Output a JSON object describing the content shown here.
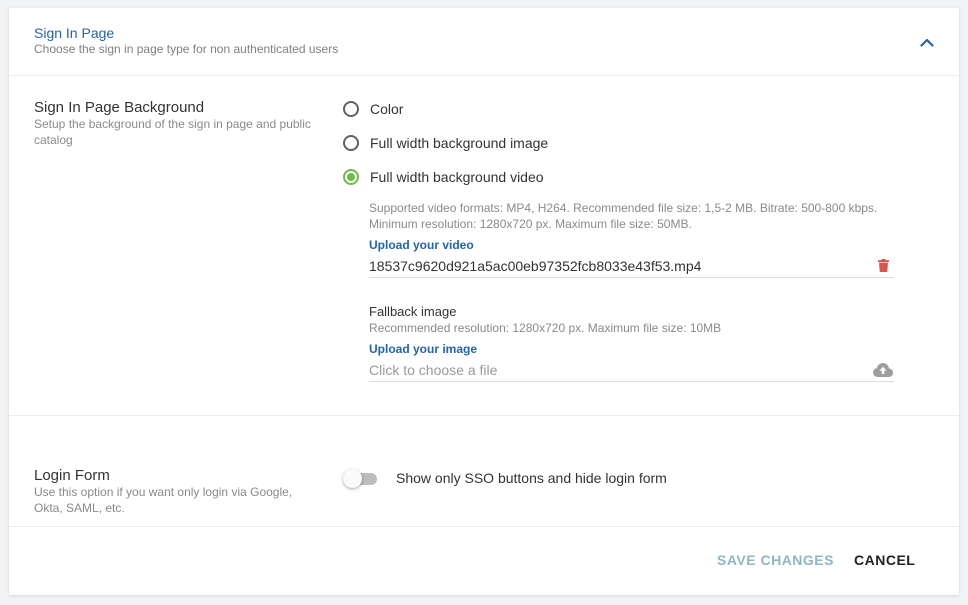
{
  "header": {
    "title": "Sign In Page",
    "subtitle": "Choose the sign in page type for non authenticated users",
    "collapse_icon": "chevron-up-icon"
  },
  "background_section": {
    "title": "Sign In Page Background",
    "description": "Setup the background of the sign in page and public catalog",
    "options": [
      {
        "label": "Color",
        "checked": false
      },
      {
        "label": "Full width background image",
        "checked": false
      },
      {
        "label": "Full width background video",
        "checked": true
      }
    ],
    "video": {
      "hint": "Supported video formats: MP4, H264. Recommended file size: 1,5-2 MB. Bitrate: 500-800 kbps. Minimum resolution: 1280x720 px. Maximum file size: 50MB.",
      "upload_label": "Upload your video",
      "file_name": "18537c9620d921a5ac00eb97352fcb8033e43f53.mp4",
      "delete_icon": "trash-icon",
      "delete_color": "#d9534f"
    },
    "fallback": {
      "title": "Fallback image",
      "hint": "Recommended resolution: 1280x720 px. Maximum file size: 10MB",
      "upload_label": "Upload your image",
      "placeholder": "Click to choose a file",
      "upload_icon": "cloud-upload-icon"
    }
  },
  "login_section": {
    "title": "Login Form",
    "description": "Use this option if you want only login via Google, Okta, SAML, etc.",
    "toggle_label": "Show only SSO buttons and hide login form",
    "toggle_on": false
  },
  "footer": {
    "save_label": "SAVE CHANGES",
    "cancel_label": "CANCEL"
  },
  "colors": {
    "accent_blue": "#2464a8",
    "radio_checked": "#6cbd45",
    "save_disabled": "#8bb8c4"
  }
}
